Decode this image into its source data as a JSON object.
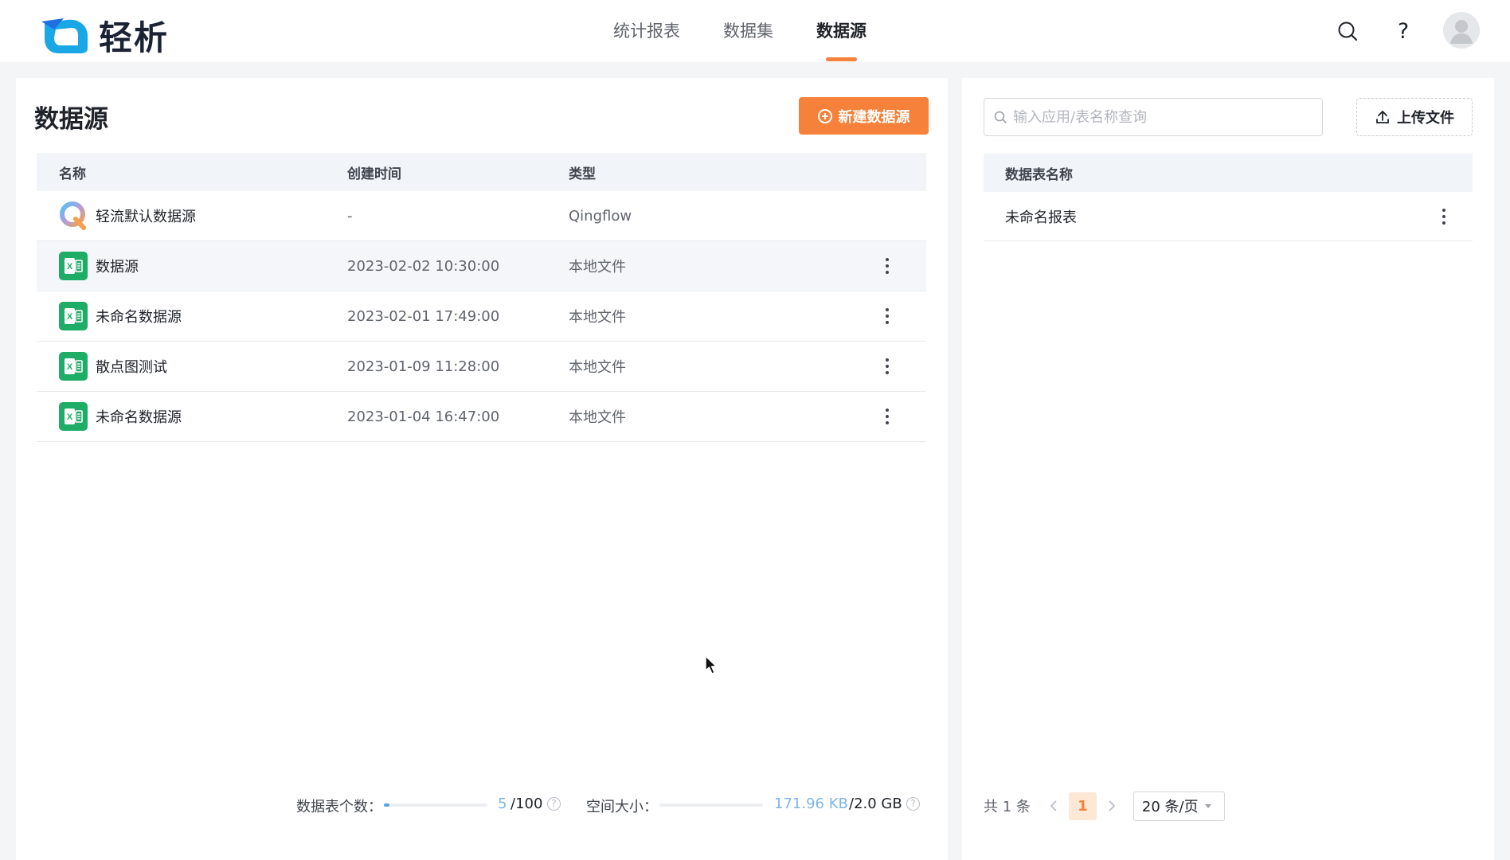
{
  "app": {
    "name": "轻析"
  },
  "nav": {
    "items": [
      "统计报表",
      "数据集",
      "数据源"
    ],
    "active": "数据源"
  },
  "header": {
    "icons": [
      "search-icon",
      "help-icon",
      "avatar"
    ]
  },
  "left": {
    "title": "数据源",
    "new_button": "新建数据源",
    "columns": {
      "name": "名称",
      "time": "创建时间",
      "type": "类型"
    },
    "rows": [
      {
        "name": "轻流默认数据源",
        "time": "-",
        "type": "Qingflow",
        "icon": "qingflow-icon",
        "has_menu": false
      },
      {
        "name": "数据源",
        "time": "2023-02-02 10:30:00",
        "type": "本地文件",
        "icon": "excel-icon",
        "has_menu": true
      },
      {
        "name": "未命名数据源",
        "time": "2023-02-01 17:49:00",
        "type": "本地文件",
        "icon": "excel-icon",
        "has_menu": true
      },
      {
        "name": "散点图测试",
        "time": "2023-01-09 11:28:00",
        "type": "本地文件",
        "icon": "excel-icon",
        "has_menu": true
      },
      {
        "name": "未命名数据源",
        "time": "2023-01-04 16:47:00",
        "type": "本地文件",
        "icon": "excel-icon",
        "has_menu": true
      }
    ],
    "stats": {
      "tables_label": "数据表个数：",
      "tables_value": "5",
      "tables_max": "/100",
      "tables_fraction": 0.05,
      "space_label": "空间大小：",
      "space_value": "171.96 KB",
      "space_max": "/2.0 GB",
      "space_fraction": 0.0001
    }
  },
  "right": {
    "search_placeholder": "输入应用/表名称查询",
    "upload_button": "上传文件",
    "column": "数据表名称",
    "rows": [
      {
        "name": "未命名报表"
      }
    ],
    "pager": {
      "total": "共 1 条",
      "current": "1",
      "page_size": "20 条/页"
    }
  },
  "colors": {
    "accent": "#f5813a",
    "excel": "#1fac67",
    "link": "#58a3e6"
  }
}
